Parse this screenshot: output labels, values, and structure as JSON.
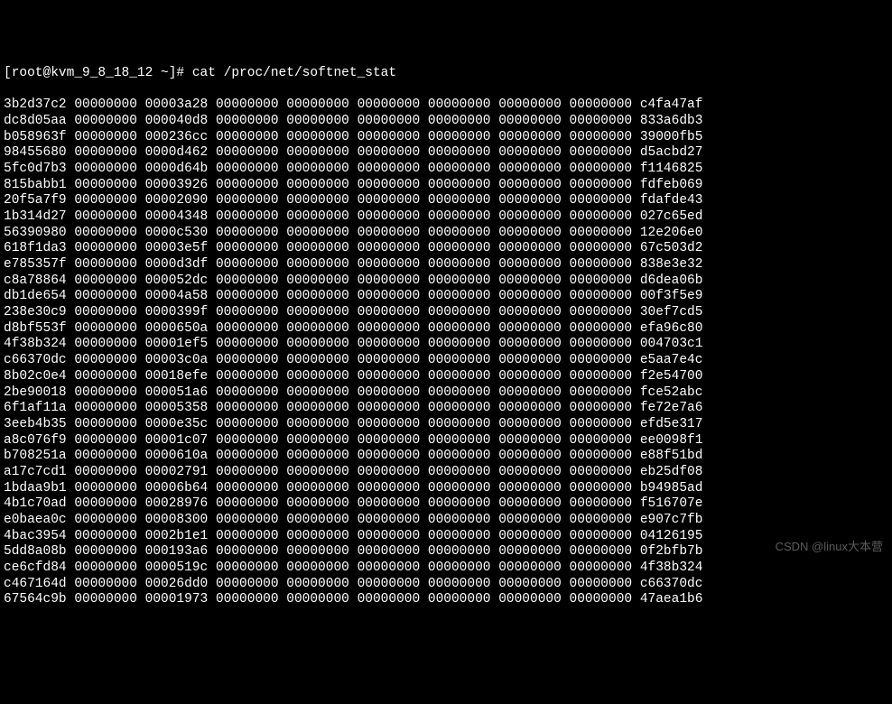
{
  "prompt": "[root@kvm_9_8_18_12 ~]# ",
  "command": "cat /proc/net/softnet_stat",
  "columns_sep": " ",
  "rows": [
    [
      "3b2d37c2",
      "00000000",
      "00003a28",
      "00000000",
      "00000000",
      "00000000",
      "00000000",
      "00000000",
      "00000000",
      "c4fa47af"
    ],
    [
      "dc8d05aa",
      "00000000",
      "000040d8",
      "00000000",
      "00000000",
      "00000000",
      "00000000",
      "00000000",
      "00000000",
      "833a6db3"
    ],
    [
      "b058963f",
      "00000000",
      "000236cc",
      "00000000",
      "00000000",
      "00000000",
      "00000000",
      "00000000",
      "00000000",
      "39000fb5"
    ],
    [
      "98455680",
      "00000000",
      "0000d462",
      "00000000",
      "00000000",
      "00000000",
      "00000000",
      "00000000",
      "00000000",
      "d5acbd27"
    ],
    [
      "5fc0d7b3",
      "00000000",
      "0000d64b",
      "00000000",
      "00000000",
      "00000000",
      "00000000",
      "00000000",
      "00000000",
      "f1146825"
    ],
    [
      "815babb1",
      "00000000",
      "00003926",
      "00000000",
      "00000000",
      "00000000",
      "00000000",
      "00000000",
      "00000000",
      "fdfeb069"
    ],
    [
      "20f5a7f9",
      "00000000",
      "00002090",
      "00000000",
      "00000000",
      "00000000",
      "00000000",
      "00000000",
      "00000000",
      "fdafde43"
    ],
    [
      "1b314d27",
      "00000000",
      "00004348",
      "00000000",
      "00000000",
      "00000000",
      "00000000",
      "00000000",
      "00000000",
      "027c65ed"
    ],
    [
      "56390980",
      "00000000",
      "0000c530",
      "00000000",
      "00000000",
      "00000000",
      "00000000",
      "00000000",
      "00000000",
      "12e206e0"
    ],
    [
      "618f1da3",
      "00000000",
      "00003e5f",
      "00000000",
      "00000000",
      "00000000",
      "00000000",
      "00000000",
      "00000000",
      "67c503d2"
    ],
    [
      "e785357f",
      "00000000",
      "0000d3df",
      "00000000",
      "00000000",
      "00000000",
      "00000000",
      "00000000",
      "00000000",
      "838e3e32"
    ],
    [
      "c8a78864",
      "00000000",
      "000052dc",
      "00000000",
      "00000000",
      "00000000",
      "00000000",
      "00000000",
      "00000000",
      "d6dea06b"
    ],
    [
      "db1de654",
      "00000000",
      "00004a58",
      "00000000",
      "00000000",
      "00000000",
      "00000000",
      "00000000",
      "00000000",
      "00f3f5e9"
    ],
    [
      "238e30c9",
      "00000000",
      "0000399f",
      "00000000",
      "00000000",
      "00000000",
      "00000000",
      "00000000",
      "00000000",
      "30ef7cd5"
    ],
    [
      "d8bf553f",
      "00000000",
      "0000650a",
      "00000000",
      "00000000",
      "00000000",
      "00000000",
      "00000000",
      "00000000",
      "efa96c80"
    ],
    [
      "4f38b324",
      "00000000",
      "00001ef5",
      "00000000",
      "00000000",
      "00000000",
      "00000000",
      "00000000",
      "00000000",
      "004703c1"
    ],
    [
      "c66370dc",
      "00000000",
      "00003c0a",
      "00000000",
      "00000000",
      "00000000",
      "00000000",
      "00000000",
      "00000000",
      "e5aa7e4c"
    ],
    [
      "8b02c0e4",
      "00000000",
      "00018efe",
      "00000000",
      "00000000",
      "00000000",
      "00000000",
      "00000000",
      "00000000",
      "f2e54700"
    ],
    [
      "2be90018",
      "00000000",
      "000051a6",
      "00000000",
      "00000000",
      "00000000",
      "00000000",
      "00000000",
      "00000000",
      "fce52abc"
    ],
    [
      "6f1af11a",
      "00000000",
      "00005358",
      "00000000",
      "00000000",
      "00000000",
      "00000000",
      "00000000",
      "00000000",
      "fe72e7a6"
    ],
    [
      "3eeb4b35",
      "00000000",
      "0000e35c",
      "00000000",
      "00000000",
      "00000000",
      "00000000",
      "00000000",
      "00000000",
      "efd5e317"
    ],
    [
      "a8c076f9",
      "00000000",
      "00001c07",
      "00000000",
      "00000000",
      "00000000",
      "00000000",
      "00000000",
      "00000000",
      "ee0098f1"
    ],
    [
      "b708251a",
      "00000000",
      "0000610a",
      "00000000",
      "00000000",
      "00000000",
      "00000000",
      "00000000",
      "00000000",
      "e88f51bd"
    ],
    [
      "a17c7cd1",
      "00000000",
      "00002791",
      "00000000",
      "00000000",
      "00000000",
      "00000000",
      "00000000",
      "00000000",
      "eb25df08"
    ],
    [
      "1bdaa9b1",
      "00000000",
      "00006b64",
      "00000000",
      "00000000",
      "00000000",
      "00000000",
      "00000000",
      "00000000",
      "b94985ad"
    ],
    [
      "4b1c70ad",
      "00000000",
      "00028976",
      "00000000",
      "00000000",
      "00000000",
      "00000000",
      "00000000",
      "00000000",
      "f516707e"
    ],
    [
      "e0baea0c",
      "00000000",
      "00008300",
      "00000000",
      "00000000",
      "00000000",
      "00000000",
      "00000000",
      "00000000",
      "e907c7fb"
    ],
    [
      "4bac3954",
      "00000000",
      "0002b1e1",
      "00000000",
      "00000000",
      "00000000",
      "00000000",
      "00000000",
      "00000000",
      "04126195"
    ],
    [
      "5dd8a08b",
      "00000000",
      "000193a6",
      "00000000",
      "00000000",
      "00000000",
      "00000000",
      "00000000",
      "00000000",
      "0f2bfb7b"
    ],
    [
      "ce6cfd84",
      "00000000",
      "0000519c",
      "00000000",
      "00000000",
      "00000000",
      "00000000",
      "00000000",
      "00000000",
      "4f38b324"
    ],
    [
      "c467164d",
      "00000000",
      "00026dd0",
      "00000000",
      "00000000",
      "00000000",
      "00000000",
      "00000000",
      "00000000",
      "c66370dc"
    ],
    [
      "67564c9b",
      "00000000",
      "00001973",
      "00000000",
      "00000000",
      "00000000",
      "00000000",
      "00000000",
      "00000000",
      "47aea1b6"
    ]
  ],
  "watermark": "CSDN @linux大本营"
}
